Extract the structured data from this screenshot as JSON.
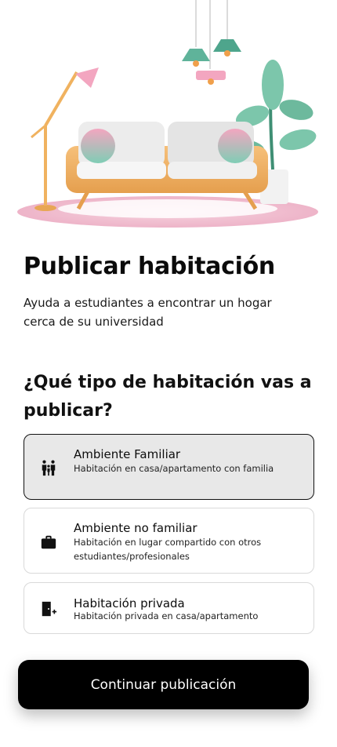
{
  "header": {
    "title": "Publicar habitación",
    "subtitle": "Ayuda a estudiantes a encontrar un hogar cerca de su universidad"
  },
  "question": "¿Qué tipo de habitación vas a publicar?",
  "options": [
    {
      "label": "Ambiente Familiar",
      "description": "Habitación en casa/apartamento con familia",
      "icon": "family-icon",
      "selected": true
    },
    {
      "label": "Ambiente no familiar",
      "description": "Habitación en lugar compartido con otros estudiantes/profesionales",
      "icon": "briefcase-icon",
      "selected": false
    },
    {
      "label": "Habitación privada",
      "description": "Habitación privada en casa/apartamento",
      "icon": "door-add-icon",
      "selected": false
    }
  ],
  "cta": {
    "label": "Continuar publicación"
  },
  "colors": {
    "primary": "#000000",
    "selected_background": "#e8e8e8",
    "border": "#d9d9d9"
  }
}
